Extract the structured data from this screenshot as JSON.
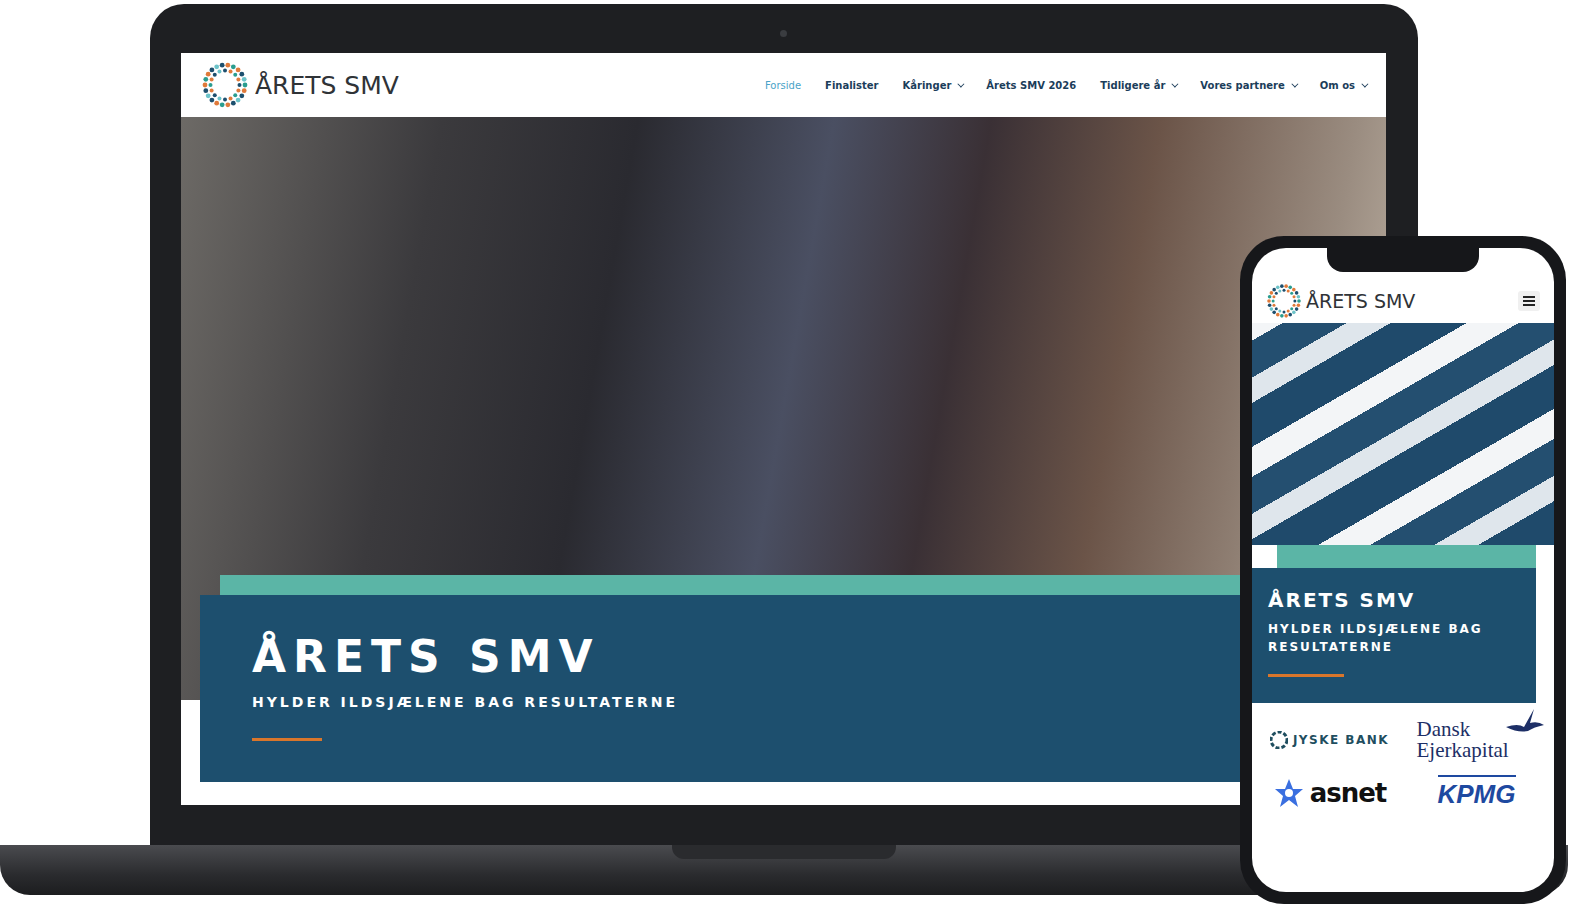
{
  "desktop": {
    "logo": "ÅRETS SMV",
    "nav": [
      {
        "label": "Forside",
        "selected": true,
        "dropdown": false
      },
      {
        "label": "Finalister",
        "selected": false,
        "dropdown": false
      },
      {
        "label": "Kåringer",
        "selected": false,
        "dropdown": true
      },
      {
        "label": "Årets SMV 2026",
        "selected": false,
        "dropdown": false
      },
      {
        "label": "Tidligere år",
        "selected": false,
        "dropdown": true
      },
      {
        "label": "Vores partnere",
        "selected": false,
        "dropdown": true
      },
      {
        "label": "Om os",
        "selected": false,
        "dropdown": true
      }
    ],
    "hero": {
      "title": "ÅRETS SMV",
      "subtitle": "HYLDER ILDSJÆLENE BAG RESULTATERNE"
    }
  },
  "mobile": {
    "logo": "ÅRETS SMV",
    "hero": {
      "title": "ÅRETS SMV",
      "subtitle": "HYLDER ILDSJÆLENE BAG RESULTATERNE"
    },
    "partners": [
      {
        "name": "JYSKE BANK",
        "kind": "jyske"
      },
      {
        "name": "Dansk Ejerkapital",
        "kind": "dansk"
      },
      {
        "name": "asnet",
        "kind": "asnet"
      },
      {
        "name": "KPMG",
        "kind": "kpmg"
      }
    ]
  }
}
